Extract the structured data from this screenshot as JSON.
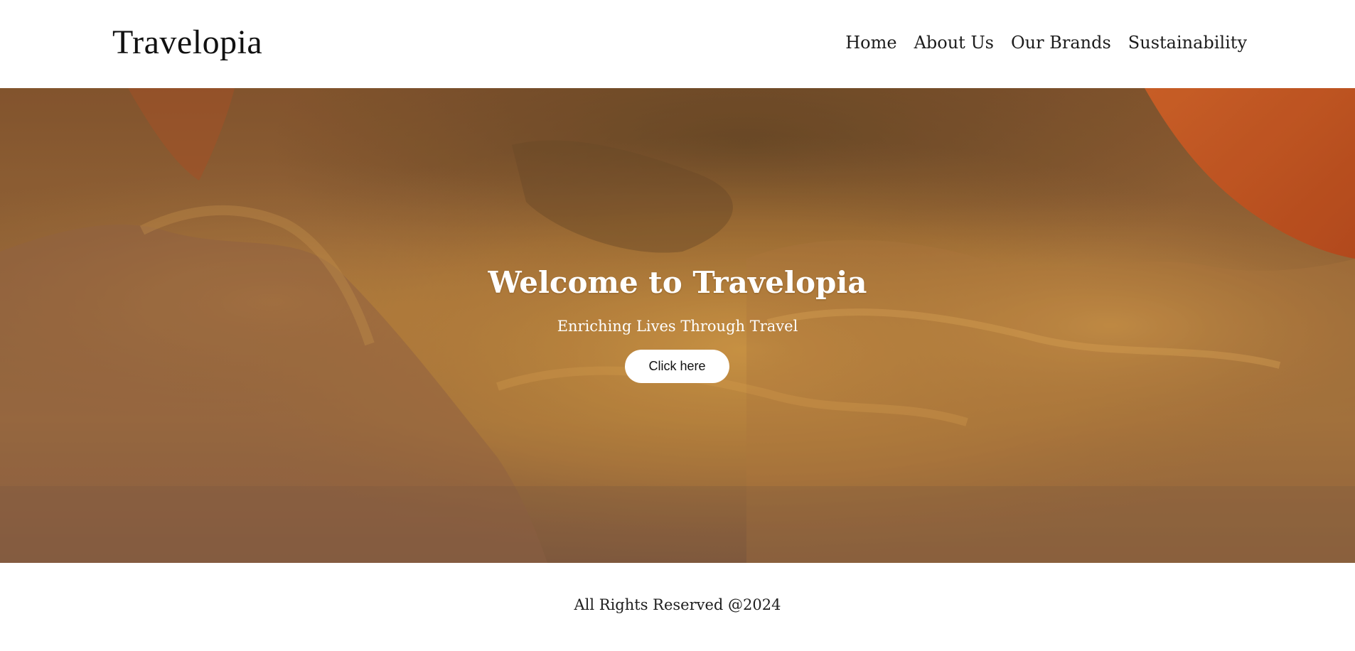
{
  "header": {
    "logo_text": "Travelopia",
    "nav": [
      {
        "label": "Home"
      },
      {
        "label": "About Us"
      },
      {
        "label": "Our Brands"
      },
      {
        "label": "Sustainability"
      }
    ]
  },
  "hero": {
    "title": "Welcome to Travelopia",
    "subtitle": "Enriching Lives Through Travel",
    "button_label": "Click here",
    "image_subject": "desert sandstone rock landscape"
  },
  "footer": {
    "text": "All Rights Reserved @2024"
  },
  "colors": {
    "header_bg": "#ffffff",
    "hero_tone": "#b07a3e",
    "hero_highlight": "#e9a13b",
    "accent_red_orange": "#d6521f",
    "button_bg": "#ffffff",
    "text_dark": "#1c1c1c"
  }
}
